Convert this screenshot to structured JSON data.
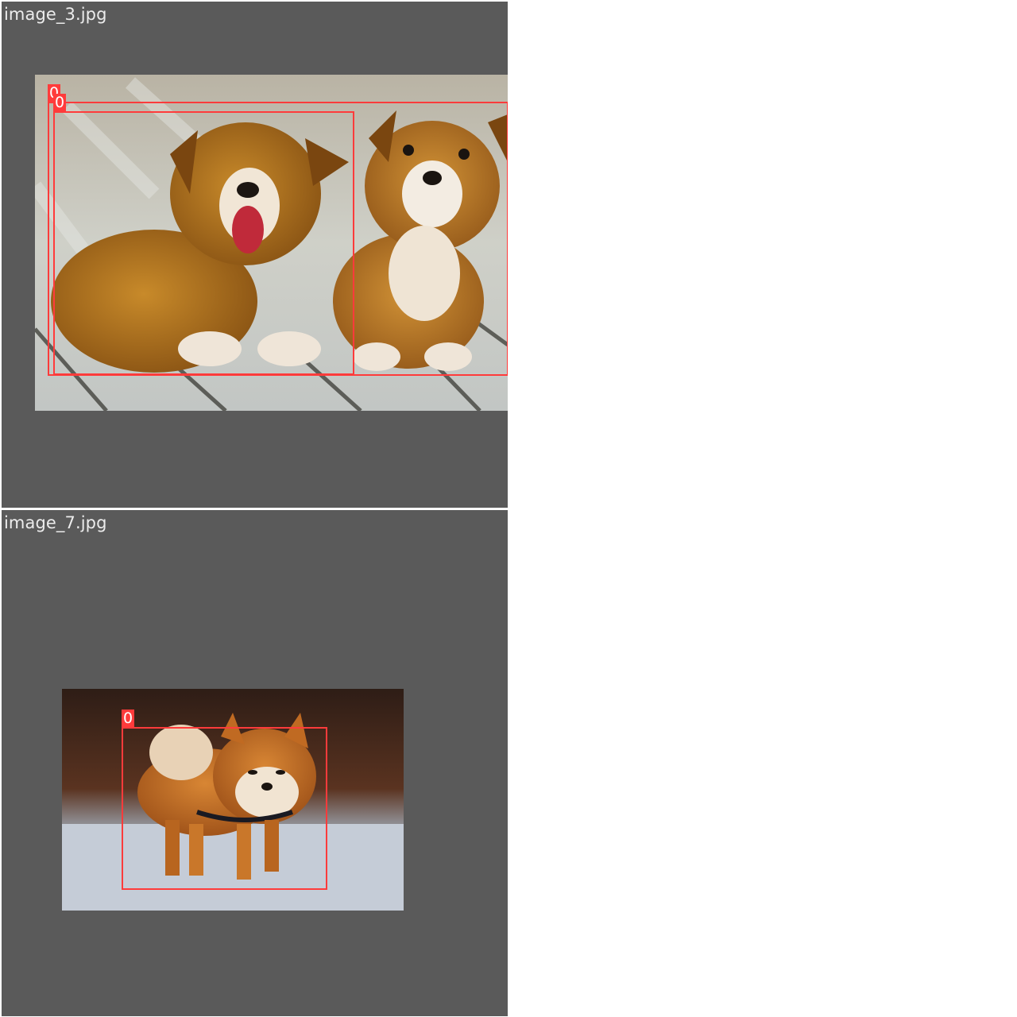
{
  "tiles": [
    {
      "filename": "image_3.jpg",
      "description_icon": "photo-two-corgi-puppies",
      "detections": [
        {
          "label": "0",
          "color": "#ff3b3b"
        },
        {
          "label": "0",
          "color": "#ff3b3b"
        }
      ]
    },
    {
      "filename": "image_7.jpg",
      "description_icon": "photo-shiba-inu-in-snow",
      "detections": [
        {
          "label": "0",
          "color": "#ff3b3b"
        }
      ]
    }
  ],
  "colors": {
    "tile_background": "#5a5a5a",
    "box": "#ff3b3b",
    "filename_text": "#ececec"
  }
}
